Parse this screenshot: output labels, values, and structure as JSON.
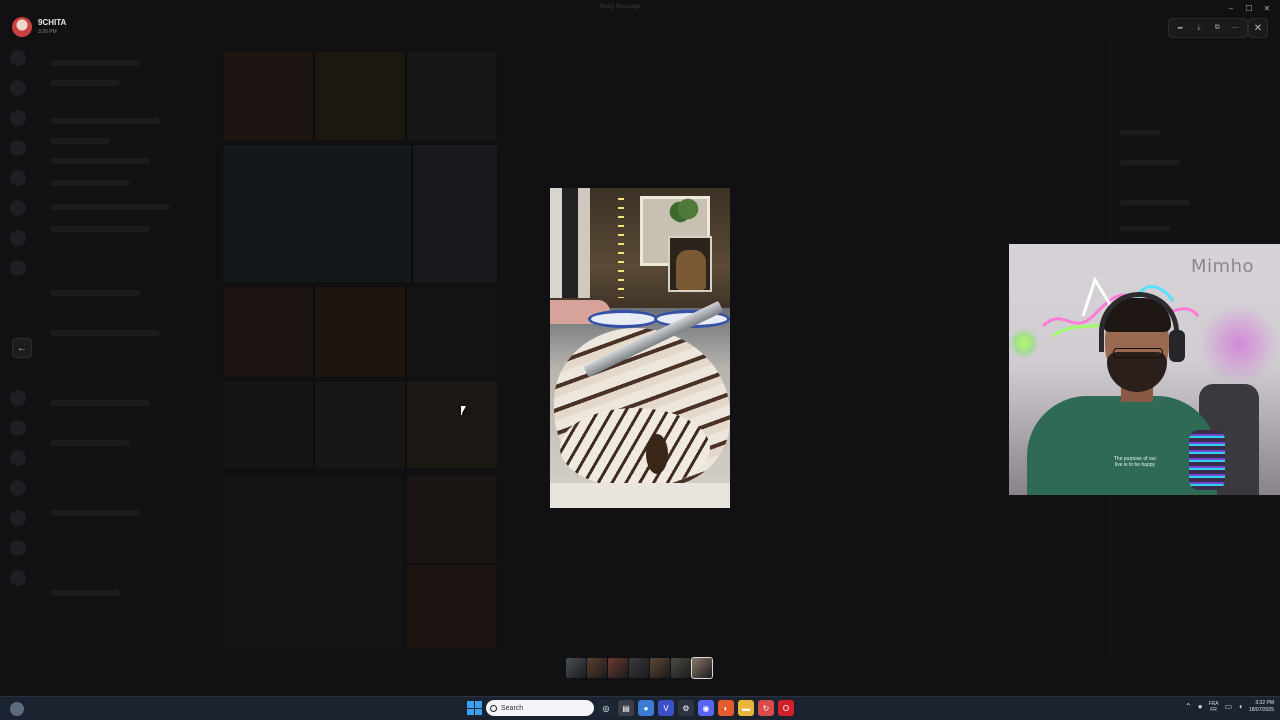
{
  "window": {
    "title": "Beeg Message"
  },
  "viewer": {
    "author_name": "9CHITA",
    "author_time": "3:20 PM",
    "toolbar_icons": [
      "forward-icon",
      "download-icon",
      "open-external-icon",
      "more-icon"
    ],
    "close_symbol": "✕",
    "back_symbol": "←"
  },
  "window_controls": {
    "minimize": "–",
    "maximize": "☐",
    "close": "✕"
  },
  "webcam": {
    "sign_text": "Mimho",
    "shirt_text": "The purpose of our live is to be happy"
  },
  "thumbnails": {
    "count": 7,
    "active_index": 6,
    "colors": [
      "#4a4f57",
      "#5a4030",
      "#6a3a30",
      "#3a3a40",
      "#5d4636",
      "#4e4a44",
      "#8a7a6c"
    ]
  },
  "taskbar": {
    "search_placeholder": "Search",
    "language_top": "FRA",
    "language_bottom": "FR",
    "time": "3:32 PM",
    "date": "18/07/2025",
    "apps": [
      {
        "name": "steam-icon",
        "color": "#1b2838",
        "glyph": "◎"
      },
      {
        "name": "notes-app-icon",
        "color": "#3a3f4a",
        "glyph": "▤"
      },
      {
        "name": "chrome-icon",
        "color": "#3a7bd5",
        "glyph": "●"
      },
      {
        "name": "vpn-icon",
        "color": "#3b4fc9",
        "glyph": "V"
      },
      {
        "name": "settings-icon",
        "color": "#2d3440",
        "glyph": "⚙"
      },
      {
        "name": "discord-icon",
        "color": "#5865f2",
        "glyph": "◉"
      },
      {
        "name": "firefox-icon",
        "color": "#e55b2d",
        "glyph": "◐"
      },
      {
        "name": "file-explorer-icon",
        "color": "#e8b43a",
        "glyph": "▬"
      },
      {
        "name": "sync-app-icon",
        "color": "#d94a4a",
        "glyph": "↻"
      },
      {
        "name": "opera-icon",
        "color": "#d0202a",
        "glyph": "O"
      }
    ]
  }
}
